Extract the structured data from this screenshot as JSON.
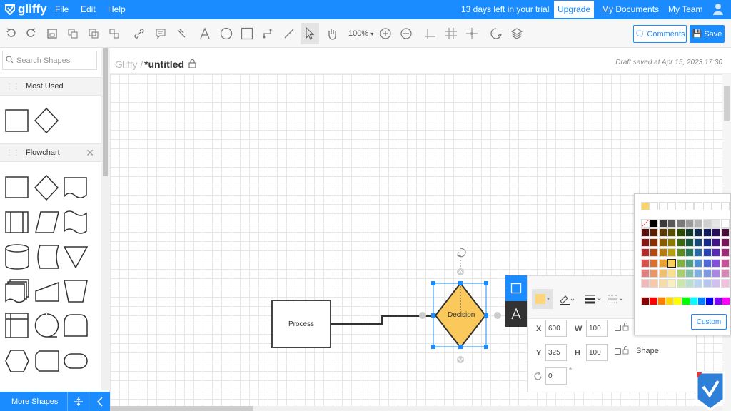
{
  "topbar": {
    "logo": "gliffy",
    "menu": [
      "File",
      "Edit",
      "Help"
    ],
    "trial": "13 days left in your trial",
    "upgrade": "Upgrade",
    "my_documents": "My Documents",
    "my_team": "My Team"
  },
  "toolbar": {
    "zoom": "100%",
    "comments": "Comments",
    "save": "Save"
  },
  "sidebar": {
    "search_placeholder": "Search Shapes",
    "most_used": "Most Used",
    "flowchart": "Flowchart",
    "more_shapes": "More Shapes"
  },
  "document": {
    "root": "Gliffy",
    "separator": "/",
    "title": "*untitled",
    "draft": "Draft saved at Apr 15, 2023 17:30"
  },
  "canvas": {
    "process_label": "Process",
    "decision_label": "Decision"
  },
  "properties": {
    "x_label": "X",
    "x_value": "600",
    "w_label": "W",
    "w_value": "100",
    "y_label": "Y",
    "y_value": "325",
    "h_label": "H",
    "h_value": "100",
    "rotation_value": "0",
    "rotation_unit": "°",
    "shape_label": "Shape"
  },
  "palette": {
    "custom": "Custom",
    "recent": [
      "#f9d26b"
    ],
    "grays": [
      "#000000",
      "#3a3a3a",
      "#595959",
      "#7a7a7a",
      "#9a9a9a",
      "#b5b5b5",
      "#cfcfcf",
      "#e5e5e5",
      "#ffffff"
    ],
    "rows": [
      [
        "#5a0f0f",
        "#5a1e00",
        "#5a3a00",
        "#5a4f00",
        "#2a4a00",
        "#0f3a2a",
        "#0f2a4a",
        "#0f1a5a",
        "#2a0f5a",
        "#4a0f3a"
      ],
      [
        "#8a1515",
        "#8a3000",
        "#8a5a00",
        "#8a7a00",
        "#3a6a10",
        "#155a40",
        "#154a7a",
        "#152a8a",
        "#40158a",
        "#7a155a"
      ],
      [
        "#b52a2a",
        "#b54a10",
        "#b57a10",
        "#b5a010",
        "#5a8a20",
        "#2a7a5a",
        "#2a6aaa",
        "#2a40b5",
        "#5a2ab5",
        "#a02a7a"
      ],
      [
        "#d85050",
        "#d87030",
        "#e8a030",
        "#f8d060",
        "#80b040",
        "#50a080",
        "#5090d0",
        "#5068d8",
        "#8050d8",
        "#c85098"
      ],
      [
        "#e08080",
        "#e89868",
        "#f0c070",
        "#f8e090",
        "#a8d070",
        "#80c0a8",
        "#80b0e0",
        "#8098e0",
        "#a888e0",
        "#d888b8"
      ],
      [
        "#f0b8b8",
        "#f8c8a8",
        "#f8dca8",
        "#f8f0c0",
        "#cce8a8",
        "#b8e0d0",
        "#b8d4f0",
        "#b8c4f0",
        "#d0c0f0",
        "#f0c0dc"
      ]
    ],
    "bright": [
      "#8b0000",
      "#ff0000",
      "#ff8000",
      "#ffd700",
      "#ffff00",
      "#00ff00",
      "#00ffff",
      "#0080ff",
      "#0000ff",
      "#8000ff",
      "#ff00ff"
    ]
  }
}
